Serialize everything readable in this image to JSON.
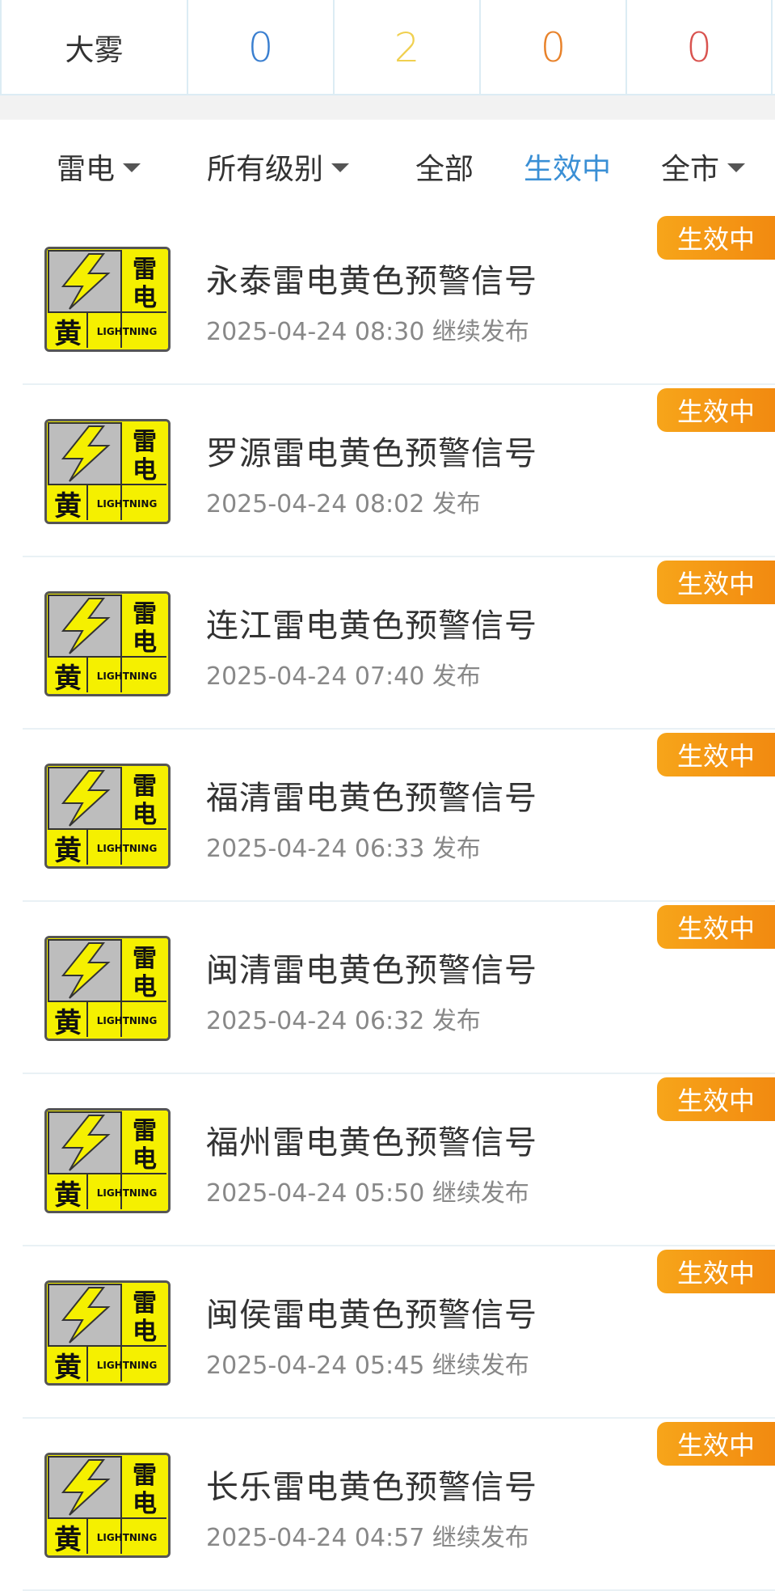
{
  "summary": {
    "label": "大雾",
    "counts": [
      {
        "value": "0",
        "color": "#3a7fd0"
      },
      {
        "value": "2",
        "color": "#f0d050"
      },
      {
        "value": "0",
        "color": "#e8822a"
      },
      {
        "value": "0",
        "color": "#d9534f"
      }
    ]
  },
  "filters": {
    "type": "雷电",
    "level": "所有级别",
    "all": "全部",
    "active": "生效中",
    "region": "全市"
  },
  "icon": {
    "char_top": "雷",
    "char_mid": "电",
    "char_level": "黄",
    "english": "LIGHTNING"
  },
  "items": [
    {
      "badge": "生效中",
      "title": "永泰雷电黄色预警信号",
      "time": "2025-04-24 08:30",
      "action": "继续发布"
    },
    {
      "badge": "生效中",
      "title": "罗源雷电黄色预警信号",
      "time": "2025-04-24 08:02",
      "action": "发布"
    },
    {
      "badge": "生效中",
      "title": "连江雷电黄色预警信号",
      "time": "2025-04-24 07:40",
      "action": "发布"
    },
    {
      "badge": "生效中",
      "title": "福清雷电黄色预警信号",
      "time": "2025-04-24 06:33",
      "action": "发布"
    },
    {
      "badge": "生效中",
      "title": "闽清雷电黄色预警信号",
      "time": "2025-04-24 06:32",
      "action": "发布"
    },
    {
      "badge": "生效中",
      "title": "福州雷电黄色预警信号",
      "time": "2025-04-24 05:50",
      "action": "继续发布"
    },
    {
      "badge": "生效中",
      "title": "闽侯雷电黄色预警信号",
      "time": "2025-04-24 05:45",
      "action": "继续发布"
    },
    {
      "badge": "生效中",
      "title": "长乐雷电黄色预警信号",
      "time": "2025-04-24 04:57",
      "action": "继续发布"
    }
  ]
}
